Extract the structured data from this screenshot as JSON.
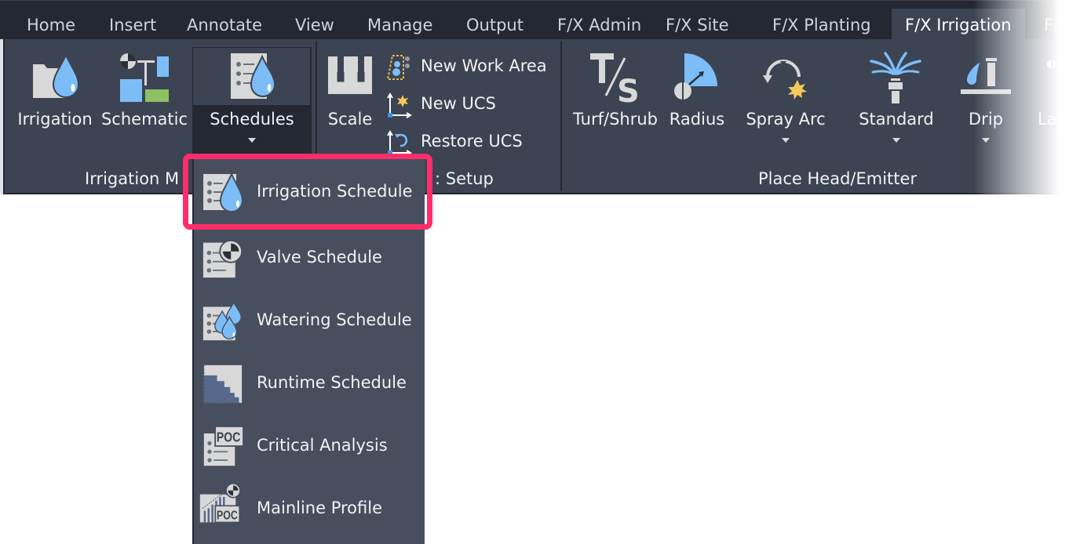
{
  "tabs": [
    {
      "label": "Home",
      "active": false
    },
    {
      "label": "Insert",
      "active": false
    },
    {
      "label": "Annotate",
      "active": false
    },
    {
      "label": "View",
      "active": false
    },
    {
      "label": "Manage",
      "active": false
    },
    {
      "label": "Output",
      "active": false
    },
    {
      "label": "F/X Admin",
      "active": false
    },
    {
      "label": "F/X Site",
      "active": false
    },
    {
      "label": "F/X Planting",
      "active": false
    },
    {
      "label": "F/X Irrigation",
      "active": true
    },
    {
      "label": "F/X",
      "active": false
    }
  ],
  "ribbon": {
    "groups": {
      "irrigation_manager": {
        "label": "Irrigation M",
        "buttons": {
          "irrigation": {
            "label": "Irrigation",
            "icon": "folder-drop-icon"
          },
          "schematic": {
            "label": "Schematic",
            "icon": "schematic-icon"
          },
          "schedules": {
            "label": "Schedules",
            "icon": "schedule-drop-icon",
            "has_dropdown": true,
            "open": true
          }
        }
      },
      "project_setup": {
        "label": ": Setup",
        "buttons": {
          "scale": {
            "label": "Scale",
            "icon": "scale-icon"
          },
          "new_work_area": {
            "label": "New Work Area",
            "icon": "work-area-icon"
          },
          "new_ucs": {
            "label": "New UCS",
            "icon": "new-ucs-icon"
          },
          "restore_ucs": {
            "label": "Restore UCS",
            "icon": "restore-ucs-icon"
          }
        }
      },
      "place_head": {
        "label": "Place Head/Emitter",
        "buttons": {
          "turf_shrub": {
            "label": "Turf/Shrub",
            "icon": "turf-shrub-icon"
          },
          "radius": {
            "label": "Radius",
            "icon": "radius-icon"
          },
          "spray_arc": {
            "label": "Spray Arc",
            "icon": "spray-arc-icon",
            "has_dropdown": true
          },
          "standard": {
            "label": "Standard",
            "icon": "sprinkler-icon",
            "has_dropdown": true
          },
          "drip": {
            "label": "Drip",
            "icon": "drip-icon",
            "has_dropdown": true
          },
          "layout": {
            "label": "Lay",
            "icon": "layout-icon",
            "has_dropdown": true
          }
        }
      }
    }
  },
  "schedules_menu": {
    "items": [
      {
        "label": "Irrigation Schedule",
        "icon": "irrigation-schedule-icon",
        "highlighted": true
      },
      {
        "label": "Valve Schedule",
        "icon": "valve-schedule-icon"
      },
      {
        "label": "Watering Schedule",
        "icon": "watering-schedule-icon"
      },
      {
        "label": "Runtime Schedule",
        "icon": "runtime-schedule-icon"
      },
      {
        "label": "Critical Analysis",
        "icon": "critical-analysis-icon"
      },
      {
        "label": "Mainline Profile",
        "icon": "mainline-profile-icon"
      }
    ],
    "highlight_color": "#ff2d6a"
  },
  "colors": {
    "tabbar_bg": "#232833",
    "ribbon_bg": "#3c4352",
    "menu_bg": "#474e5e",
    "accent_blue": "#7dbdf7",
    "accent_green": "#8dc060",
    "accent_yellow": "#f5c85a"
  }
}
